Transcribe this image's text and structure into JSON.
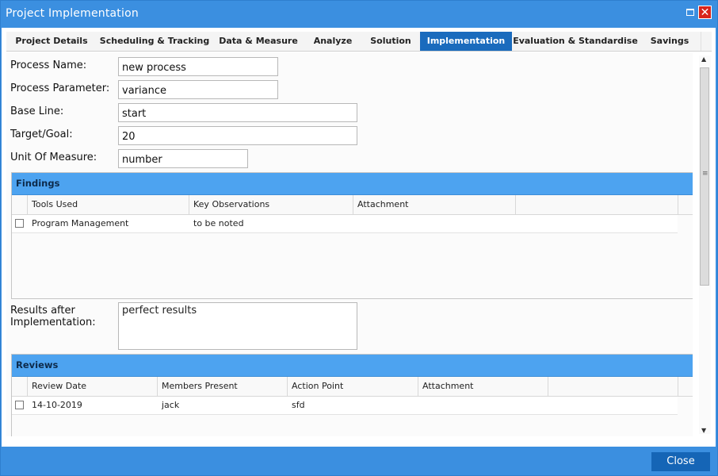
{
  "window": {
    "title": "Project Implementation",
    "accent": "#3b8fe0",
    "active_tab_color": "#1a6bbd",
    "close_icon": "close-icon",
    "maximize_icon": "maximize-icon"
  },
  "tabs": [
    {
      "label": "Project Details",
      "active": false
    },
    {
      "label": "Scheduling & Tracking",
      "active": false
    },
    {
      "label": "Data & Measure",
      "active": false
    },
    {
      "label": "Analyze",
      "active": false
    },
    {
      "label": "Solution",
      "active": false
    },
    {
      "label": "Implementation",
      "active": true
    },
    {
      "label": "Evaluation & Standardise",
      "active": false
    },
    {
      "label": "Savings",
      "active": false
    }
  ],
  "form": {
    "process_name": {
      "label": "Process Name:",
      "value": "new process"
    },
    "process_parameter": {
      "label": "Process Parameter:",
      "value": "variance"
    },
    "base_line": {
      "label": "Base Line:",
      "value": "start"
    },
    "target_goal": {
      "label": "Target/Goal:",
      "value": "20"
    },
    "unit_of_measure": {
      "label": "Unit Of Measure:",
      "value": "number"
    },
    "results": {
      "label_line1": "Results after",
      "label_line2": "Implementation:",
      "value": "perfect results"
    }
  },
  "findings": {
    "title": "Findings",
    "columns": [
      "Tools Used",
      "Key Observations",
      "Attachment",
      ""
    ],
    "rows": [
      {
        "tools_used": "Program Management",
        "key_observations": "to be noted",
        "attachment": ""
      }
    ]
  },
  "reviews": {
    "title": "Reviews",
    "columns": [
      "Review Date",
      "Members Present",
      "Action Point",
      "Attachment",
      ""
    ],
    "rows": [
      {
        "review_date": "14-10-2019",
        "members_present": "jack",
        "action_point": "sfd",
        "attachment": ""
      }
    ]
  },
  "footer": {
    "close_label": "Close"
  }
}
